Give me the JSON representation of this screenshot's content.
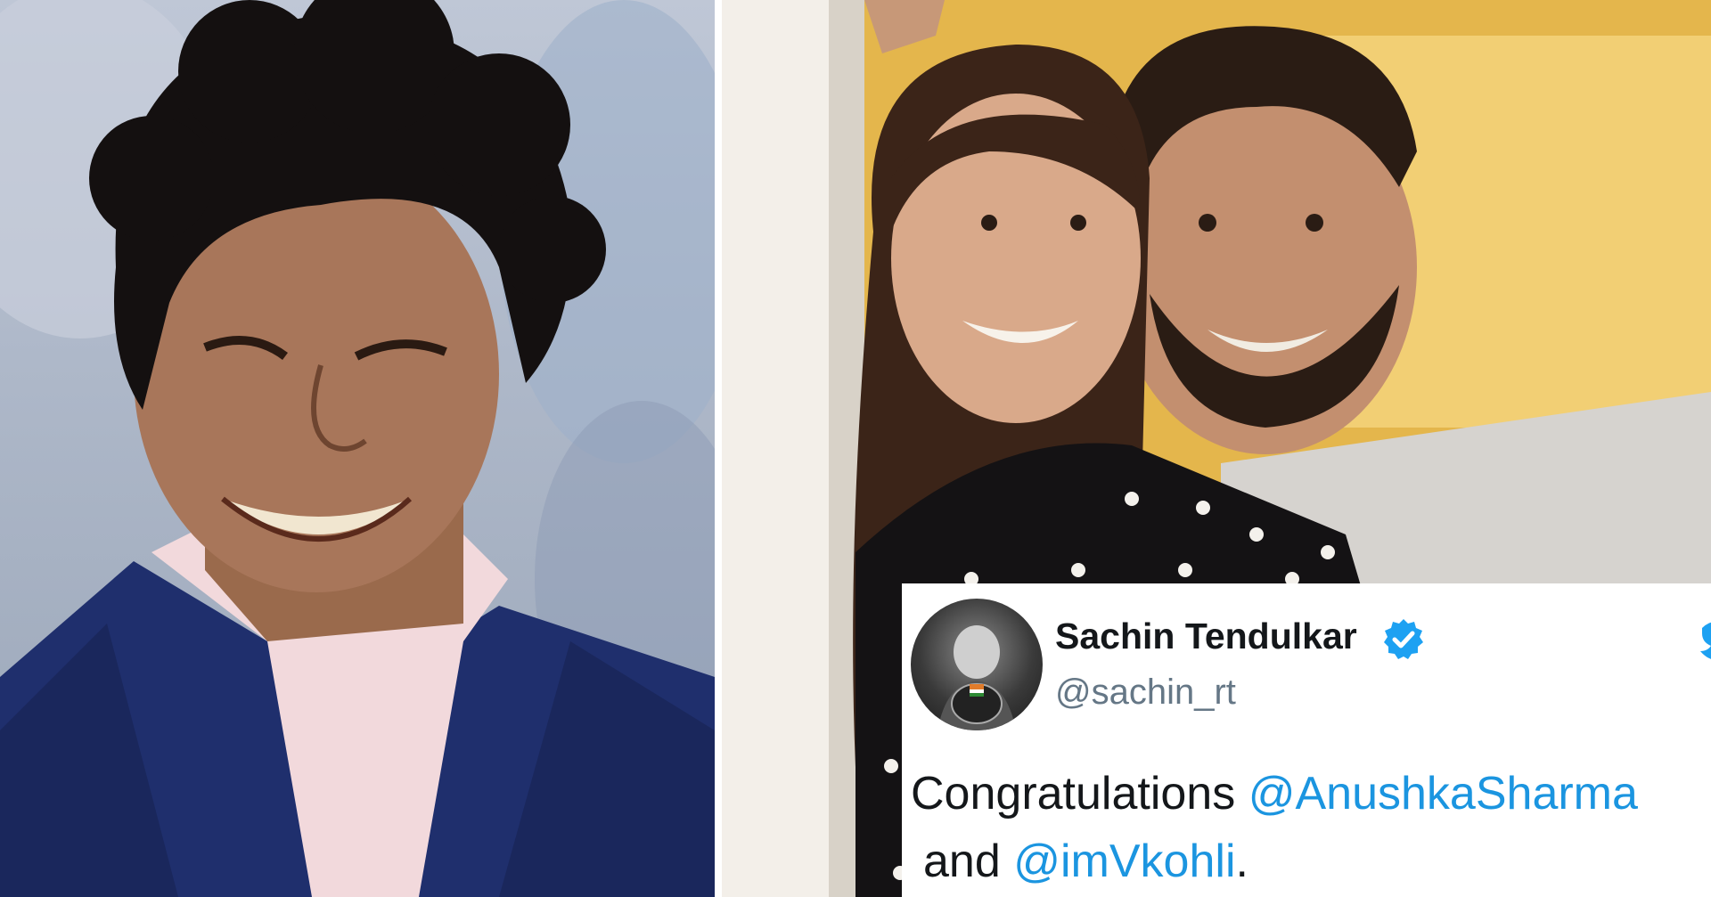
{
  "tweet": {
    "name": "Sachin Tendulkar",
    "handle": "@sachin_rt",
    "text_prefix": "Congratulations ",
    "mention_1": "@AnushkaSharma",
    "text_and": "and ",
    "mention_2": "@imVkohli",
    "text_end": "."
  },
  "colors": {
    "mention": "#1b95e0",
    "verified": "#1da1f2",
    "name": "#14171a",
    "handle": "#657786"
  },
  "icons": [
    "verified-badge-icon",
    "twitter-bird-icon"
  ]
}
